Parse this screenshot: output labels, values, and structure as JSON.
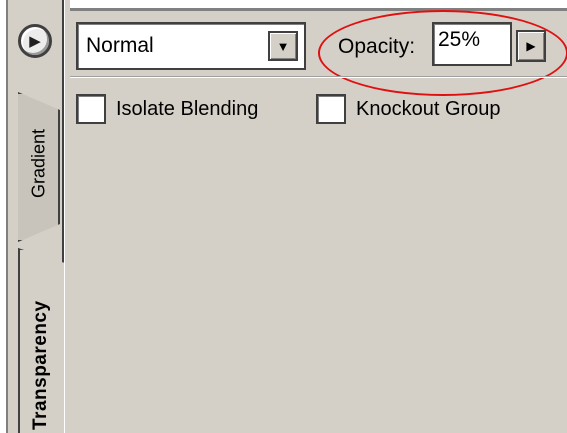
{
  "panel": {
    "tabs": [
      {
        "label": "Gradient",
        "active": false
      },
      {
        "label": "Transparency",
        "active": true
      }
    ],
    "menu_icon": "play-right-icon"
  },
  "toolbar": {
    "blend_mode": {
      "value": "Normal",
      "arrow_icon": "chevron-down-icon"
    },
    "opacity": {
      "label": "Opacity:",
      "value": "25%",
      "step_icon": "triangle-right-icon"
    }
  },
  "options": {
    "isolate_blending": {
      "label": "Isolate Blending",
      "checked": false
    },
    "knockout_group": {
      "label": "Knockout Group",
      "checked": false
    }
  },
  "colors": {
    "panel_bg": "#d4d0c8",
    "highlight": "#e01010"
  }
}
